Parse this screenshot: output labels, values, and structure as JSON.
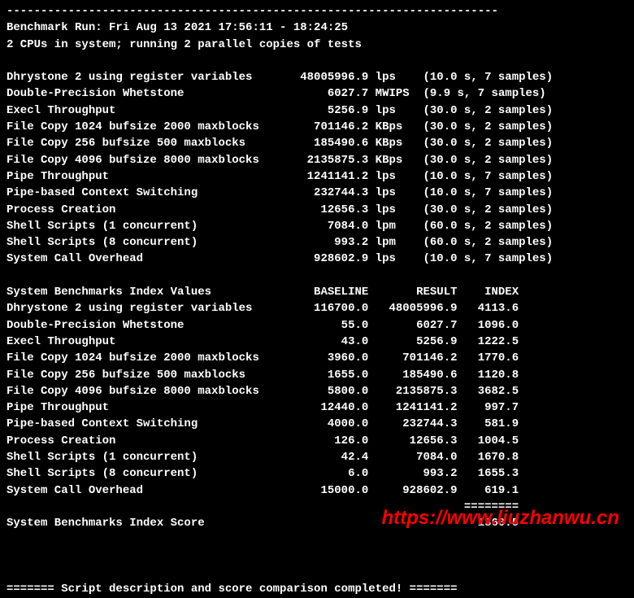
{
  "header": {
    "dashes": "------------------------------------------------------------------------",
    "run_info": "Benchmark Run: Fri Aug 13 2021 17:56:11 - 18:24:25",
    "cpu_info": "2 CPUs in system; running 2 parallel copies of tests"
  },
  "results": [
    {
      "name": "Dhrystone 2 using register variables",
      "value": "48005996.9",
      "unit": "lps",
      "timing": "(10.0 s, 7 samples)"
    },
    {
      "name": "Double-Precision Whetstone",
      "value": "6027.7",
      "unit": "MWIPS",
      "timing": "(9.9 s, 7 samples)"
    },
    {
      "name": "Execl Throughput",
      "value": "5256.9",
      "unit": "lps",
      "timing": "(30.0 s, 2 samples)"
    },
    {
      "name": "File Copy 1024 bufsize 2000 maxblocks",
      "value": "701146.2",
      "unit": "KBps",
      "timing": "(30.0 s, 2 samples)"
    },
    {
      "name": "File Copy 256 bufsize 500 maxblocks",
      "value": "185490.6",
      "unit": "KBps",
      "timing": "(30.0 s, 2 samples)"
    },
    {
      "name": "File Copy 4096 bufsize 8000 maxblocks",
      "value": "2135875.3",
      "unit": "KBps",
      "timing": "(30.0 s, 2 samples)"
    },
    {
      "name": "Pipe Throughput",
      "value": "1241141.2",
      "unit": "lps",
      "timing": "(10.0 s, 7 samples)"
    },
    {
      "name": "Pipe-based Context Switching",
      "value": "232744.3",
      "unit": "lps",
      "timing": "(10.0 s, 7 samples)"
    },
    {
      "name": "Process Creation",
      "value": "12656.3",
      "unit": "lps",
      "timing": "(30.0 s, 2 samples)"
    },
    {
      "name": "Shell Scripts (1 concurrent)",
      "value": "7084.0",
      "unit": "lpm",
      "timing": "(60.0 s, 2 samples)"
    },
    {
      "name": "Shell Scripts (8 concurrent)",
      "value": "993.2",
      "unit": "lpm",
      "timing": "(60.0 s, 2 samples)"
    },
    {
      "name": "System Call Overhead",
      "value": "928602.9",
      "unit": "lps",
      "timing": "(10.0 s, 7 samples)"
    }
  ],
  "index_header": {
    "title": "System Benchmarks Index Values",
    "col1": "BASELINE",
    "col2": "RESULT",
    "col3": "INDEX"
  },
  "index_rows": [
    {
      "name": "Dhrystone 2 using register variables",
      "baseline": "116700.0",
      "result": "48005996.9",
      "index": "4113.6"
    },
    {
      "name": "Double-Precision Whetstone",
      "baseline": "55.0",
      "result": "6027.7",
      "index": "1096.0"
    },
    {
      "name": "Execl Throughput",
      "baseline": "43.0",
      "result": "5256.9",
      "index": "1222.5"
    },
    {
      "name": "File Copy 1024 bufsize 2000 maxblocks",
      "baseline": "3960.0",
      "result": "701146.2",
      "index": "1770.6"
    },
    {
      "name": "File Copy 256 bufsize 500 maxblocks",
      "baseline": "1655.0",
      "result": "185490.6",
      "index": "1120.8"
    },
    {
      "name": "File Copy 4096 bufsize 8000 maxblocks",
      "baseline": "5800.0",
      "result": "2135875.3",
      "index": "3682.5"
    },
    {
      "name": "Pipe Throughput",
      "baseline": "12440.0",
      "result": "1241141.2",
      "index": "997.7"
    },
    {
      "name": "Pipe-based Context Switching",
      "baseline": "4000.0",
      "result": "232744.3",
      "index": "581.9"
    },
    {
      "name": "Process Creation",
      "baseline": "126.0",
      "result": "12656.3",
      "index": "1004.5"
    },
    {
      "name": "Shell Scripts (1 concurrent)",
      "baseline": "42.4",
      "result": "7084.0",
      "index": "1670.8"
    },
    {
      "name": "Shell Scripts (8 concurrent)",
      "baseline": "6.0",
      "result": "993.2",
      "index": "1655.3"
    },
    {
      "name": "System Call Overhead",
      "baseline": "15000.0",
      "result": "928602.9",
      "index": "619.1"
    }
  ],
  "score_divider": "                                                                   ========",
  "score": {
    "label": "System Benchmarks Index Score",
    "value": "1360.5"
  },
  "footer": "======= Script description and score comparison completed! =======",
  "watermark": "https://www.liuzhanwu.cn"
}
